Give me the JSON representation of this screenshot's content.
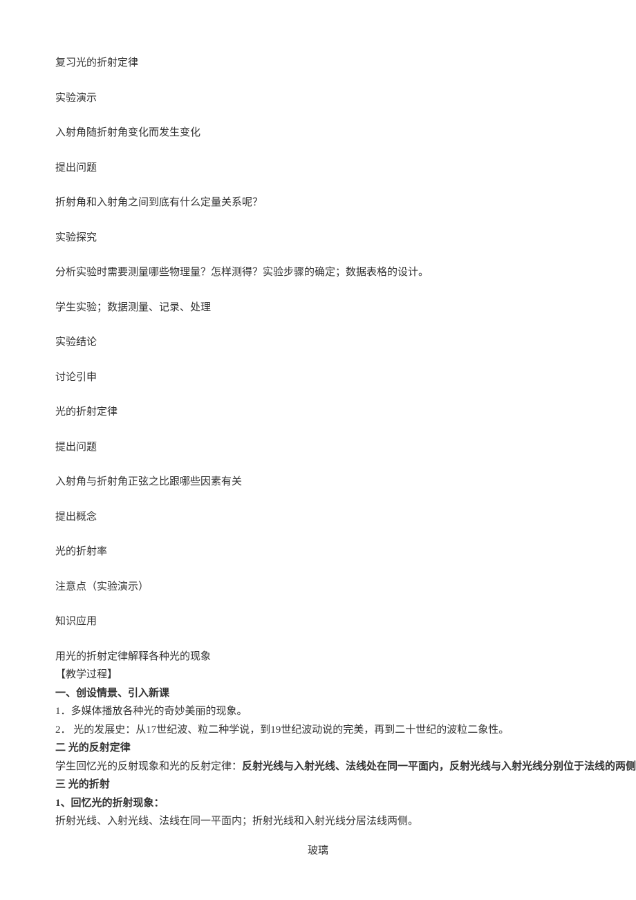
{
  "lines": {
    "l1": "复习光的折射定律",
    "l2": "实验演示",
    "l3": "入射角随折射角变化而发生变化",
    "l4": "提出问题",
    "l5": "折射角和入射角之间到底有什么定量关系呢？",
    "l6": "实验探究",
    "l7": "分析实验时需要测量哪些物理量？怎样测得？实验步骤的确定；数据表格的设计。",
    "l8": "学生实验；数据测量、记录、处理",
    "l9": "实验结论",
    "l10": "讨论引申",
    "l11": "光的折射定律",
    "l12": "提出问题",
    "l13": "入射角与折射角正弦之比跟哪些因素有关",
    "l14": "提出概念",
    "l15": "光的折射率",
    "l16": "注意点（实验演示）",
    "l17": "知识应用",
    "l18": "用光的折射定律解释各种光的现象",
    "l19": "【教学过程】",
    "l20": "一、创设情景、引入新课",
    "l21": "1．多媒体播放各种光的奇妙美丽的现象。",
    "l22": "2． 光的发展史：从17世纪波、粒二种学说，到19世纪波动说的完美，再到二十世纪的波粒二象性。",
    "l23": "二 光的反射定律",
    "l24_prefix": "学生回忆光的反射现象和光的反射定律：",
    "l24_bold": "反射光线与入射光线、法线处在同一平面内，反射光线与入射光线分别位于法线的两侧；反射角",
    "l25": "三 光的折射",
    "l26": "1、回忆光的折射现象：",
    "l27": "折射光线、入射光线、法线在同一平面内；折射光线和入射光线分居法线两侧。",
    "footer": "玻璃"
  }
}
